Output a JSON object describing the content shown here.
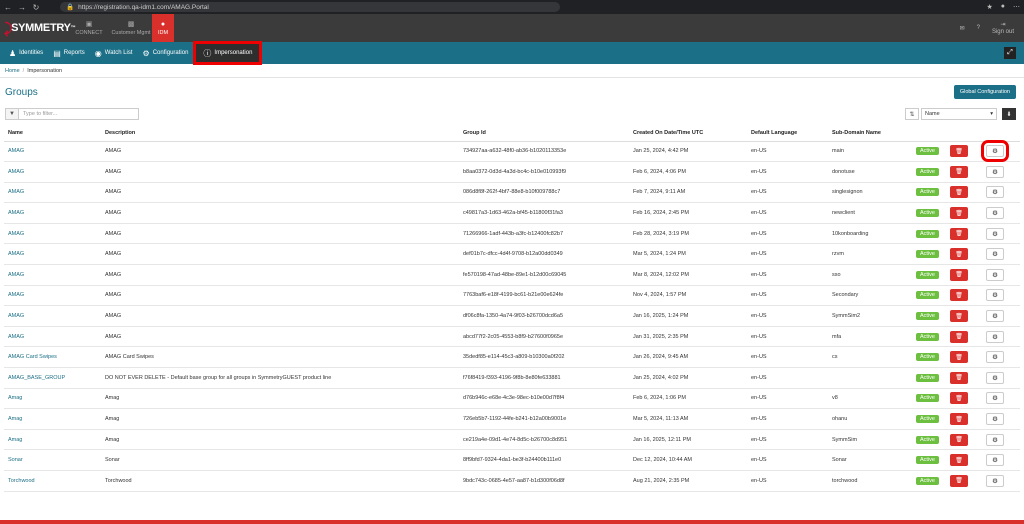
{
  "browser": {
    "url": "https://registration.qa-idm1.com/AMAG.Portal"
  },
  "app": {
    "logo": "SYMMETRY"
  },
  "topnav": [
    {
      "label": "CONNECT",
      "icon": "monitor-icon",
      "active": false
    },
    {
      "label": "Customer Mgmt",
      "icon": "briefcase-icon",
      "active": false
    },
    {
      "label": "IDM",
      "icon": "user-icon",
      "active": true
    }
  ],
  "topnav_right": {
    "signout": "Sign out"
  },
  "subnav": [
    {
      "label": "Identities",
      "icon": "users-icon"
    },
    {
      "label": "Reports",
      "icon": "chart-icon"
    },
    {
      "label": "Watch List",
      "icon": "eye-icon"
    },
    {
      "label": "Configuration",
      "icon": "gear-icon"
    },
    {
      "label": "Impersonation",
      "icon": "info-icon"
    }
  ],
  "breadcrumb": {
    "home": "Home",
    "current": "Impersonation"
  },
  "page": {
    "title": "Groups",
    "global_config": "Global Configuration"
  },
  "filter": {
    "placeholder": "Type to filter..."
  },
  "sort": {
    "field": "Name"
  },
  "table": {
    "columns": [
      "Name",
      "Description",
      "Group Id",
      "Created On Date/Time UTC",
      "Default Language",
      "Sub-Domain Name"
    ],
    "rows": [
      {
        "name": "AMAG",
        "description": "AMAG",
        "group_id": "734927aa-a632-48f0-ab36-b1020113353e",
        "created": "Jan 25, 2024, 4:42 PM",
        "language": "en-US",
        "subdomain": "main",
        "status": "Active"
      },
      {
        "name": "AMAG",
        "description": "AMAG",
        "group_id": "b8aa0372-0d3d-4a3d-bc4c-b10e010993f9",
        "created": "Feb 6, 2024, 4:06 PM",
        "language": "en-US",
        "subdomain": "donotuse",
        "status": "Active"
      },
      {
        "name": "AMAG",
        "description": "AMAG",
        "group_id": "086d8f8f-262f-4bf7-88e8-b10f009788c7",
        "created": "Feb 7, 2024, 9:11 AM",
        "language": "en-US",
        "subdomain": "singlesignon",
        "status": "Active"
      },
      {
        "name": "AMAG",
        "description": "AMAG",
        "group_id": "c49817a3-1d63-462a-bf45-b11800f31fa3",
        "created": "Feb 16, 2024, 2:45 PM",
        "language": "en-US",
        "subdomain": "newclient",
        "status": "Active"
      },
      {
        "name": "AMAG",
        "description": "AMAG",
        "group_id": "71266966-1adf-443b-a3fc-b12400fc82b7",
        "created": "Feb 28, 2024, 3:19 PM",
        "language": "en-US",
        "subdomain": "10konboarding",
        "status": "Active"
      },
      {
        "name": "AMAG",
        "description": "AMAG",
        "group_id": "def01b7c-dfcc-4d4f-9708-b12a00dd0349",
        "created": "Mar 5, 2024, 1:24 PM",
        "language": "en-US",
        "subdomain": "rzvm",
        "status": "Active"
      },
      {
        "name": "AMAG",
        "description": "AMAG",
        "group_id": "fe570198-47ad-48be-89e1-b12d00c69045",
        "created": "Mar 8, 2024, 12:02 PM",
        "language": "en-US",
        "subdomain": "sso",
        "status": "Active"
      },
      {
        "name": "AMAG",
        "description": "AMAG",
        "group_id": "7763baf6-e18f-4199-bc61-b21e00e624fe",
        "created": "Nov 4, 2024, 1:57 PM",
        "language": "en-US",
        "subdomain": "Secondary",
        "status": "Active"
      },
      {
        "name": "AMAG",
        "description": "AMAG",
        "group_id": "df06c8fa-1350-4a74-9f03-b26700dcd6a5",
        "created": "Jan 16, 2025, 1:24 PM",
        "language": "en-US",
        "subdomain": "SymmSim2",
        "status": "Active"
      },
      {
        "name": "AMAG",
        "description": "AMAG",
        "group_id": "abcd77f2-2c05-4553-b8f9-b27600f0965e",
        "created": "Jan 31, 2025, 2:35 PM",
        "language": "en-US",
        "subdomain": "mfa",
        "status": "Active"
      },
      {
        "name": "AMAG Card Swipes",
        "description": "AMAG Card Swipes",
        "group_id": "35dedf85-e114-45c3-a809-b10300a0f202",
        "created": "Jan 26, 2024, 9:45 AM",
        "language": "en-US",
        "subdomain": "cs",
        "status": "Active"
      },
      {
        "name": "AMAG_BASE_GROUP",
        "description": "DO NOT EVER DELETE - Default base group for all groups in SymmetryGUEST product line",
        "group_id": "f76f8419-f393-4196-9f8b-8e80fe633881",
        "created": "Jan 25, 2024, 4:02 PM",
        "language": "en-US",
        "subdomain": "",
        "status": "Active"
      },
      {
        "name": "Amag",
        "description": "Amag",
        "group_id": "d76b946c-e68e-4c3e-98ec-b10e00d7f8f4",
        "created": "Feb 6, 2024, 1:06 PM",
        "language": "en-US",
        "subdomain": "v8",
        "status": "Active"
      },
      {
        "name": "Amag",
        "description": "Amag",
        "group_id": "726eb5b7-1192-44fe-b241-b12a00b9001e",
        "created": "Mar 5, 2024, 11:13 AM",
        "language": "en-US",
        "subdomain": "ohanu",
        "status": "Active"
      },
      {
        "name": "Amag",
        "description": "Amag",
        "group_id": "ce219a4e-09d1-4e74-8d5c-b26700c8d951",
        "created": "Jan 16, 2025, 12:11 PM",
        "language": "en-US",
        "subdomain": "SymmSim",
        "status": "Active"
      },
      {
        "name": "Sonar",
        "description": "Sonar",
        "group_id": "8ff9bfd7-9324-4da1-be3f-b24400b111e0",
        "created": "Dec 12, 2024, 10:44 AM",
        "language": "en-US",
        "subdomain": "Sonar",
        "status": "Active"
      },
      {
        "name": "Torchwood",
        "description": "Torchwood",
        "group_id": "9bdc743c-0685-4e57-aa87-b1d300f06d8f",
        "created": "Aug 21, 2024, 2:35 PM",
        "language": "en-US",
        "subdomain": "torchwood",
        "status": "Active"
      }
    ]
  }
}
